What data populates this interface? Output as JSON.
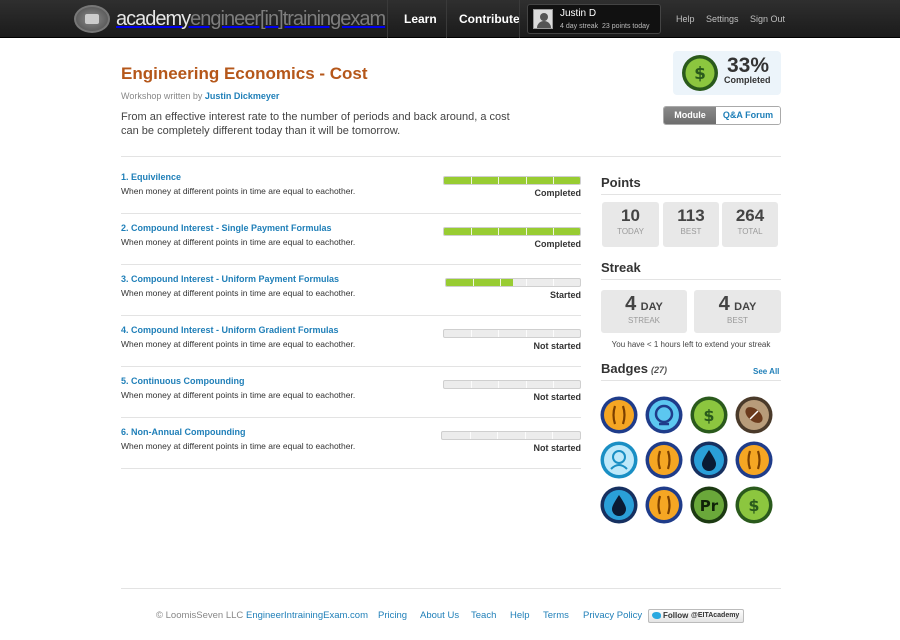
{
  "header": {
    "logo_primary": "academy",
    "logo_secondary": "engineer[in]trainingexam",
    "nav": [
      {
        "label": "Learn"
      },
      {
        "label": "Contribute"
      }
    ],
    "user": {
      "name": "Justin D",
      "streak": "4 day streak",
      "points": "23 points today"
    },
    "links": [
      {
        "label": "Help"
      },
      {
        "label": "Settings"
      },
      {
        "label": "Sign Out"
      }
    ]
  },
  "workshop": {
    "title": "Engineering Economics - Cost",
    "byline_prefix": "Workshop written by",
    "author": "Justin Dickmeyer",
    "intro": "From an effective interest rate to the number of periods and back around, a cost can be completely different today than it will be tomorrow.",
    "progress_percent": "33%",
    "progress_label": "Completed"
  },
  "view_toggle": {
    "module": "Module",
    "forum": "Q&A Forum"
  },
  "modules": [
    {
      "title": "1.  Equivilence",
      "desc": "When money at different points in time are equal to eachother.",
      "status": "Completed",
      "progress": 1.0
    },
    {
      "title": "2. Compound Interest - Single Payment Formulas",
      "desc": "When money at different points in time are equal to eachother.",
      "status": "Completed",
      "progress": 1.0
    },
    {
      "title": "3. Compound Interest - Uniform Payment Formulas",
      "desc": "When money at different points in time are equal to eachother.",
      "status": "Started",
      "progress": 0.5
    },
    {
      "title": "4. Compound Interest - Uniform Gradient Formulas",
      "desc": "When money at different points in time are equal to eachother.",
      "status": "Not started",
      "progress": 0
    },
    {
      "title": "5. Continuous Compounding",
      "desc": "When money at different points in time are equal to eachother.",
      "status": "Not started",
      "progress": 0
    },
    {
      "title": "6. Non-Annual Compounding",
      "desc": "When money at different points in time are equal to eachother.",
      "status": "Not started",
      "progress": 0
    }
  ],
  "points": {
    "heading": "Points",
    "stats": [
      {
        "value": "10",
        "label": "TODAY"
      },
      {
        "value": "113",
        "label": "BEST"
      },
      {
        "value": "264",
        "label": "TOTAL"
      }
    ]
  },
  "streak": {
    "heading": "Streak",
    "current": {
      "value": "4",
      "unit": "DAY",
      "label": "STREAK"
    },
    "best": {
      "value": "4",
      "unit": "DAY",
      "label": "BEST"
    },
    "note": "You have < 1 hours left to extend your streak"
  },
  "badges": {
    "heading": "Badges",
    "count": "(27)",
    "see_all": "See All",
    "items": [
      {
        "icon": "orange-scroll-badge-icon",
        "ring": "#1f3c8a",
        "fill": "#f5a623"
      },
      {
        "icon": "blue-chat-badge-icon",
        "ring": "#1f3c8a",
        "fill": "#5cc7f0"
      },
      {
        "icon": "green-dollar-badge-icon",
        "ring": "#2a5a1c",
        "fill": "#8cc63f"
      },
      {
        "icon": "brown-football-badge-icon",
        "ring": "#4a3a2a",
        "fill": "#b89c7a"
      },
      {
        "icon": "blue-person-badge-icon",
        "ring": "#1a8fc4",
        "fill": "#bfe9fa"
      },
      {
        "icon": "orange-scroll-badge-icon",
        "ring": "#1f3c8a",
        "fill": "#f5a623"
      },
      {
        "icon": "blue-drop-badge-icon",
        "ring": "#163060",
        "fill": "#2a9fd8"
      },
      {
        "icon": "orange-scroll-badge-icon",
        "ring": "#1f3c8a",
        "fill": "#f5a623"
      },
      {
        "icon": "blue-drop-badge-icon",
        "ring": "#163060",
        "fill": "#2a9fd8"
      },
      {
        "icon": "orange-scroll-badge-icon",
        "ring": "#1f3c8a",
        "fill": "#f5a623"
      },
      {
        "icon": "green-pr-badge-icon",
        "ring": "#1c3a12",
        "fill": "#6aa83a",
        "text": "Pr"
      },
      {
        "icon": "green-dollar-badge-icon",
        "ring": "#2a5a1c",
        "fill": "#8cc63f"
      }
    ]
  },
  "footer": {
    "copyright": "© LoomisSeven LLC",
    "links": [
      {
        "label": "EngineerIntrainingExam.com"
      },
      {
        "label": "Pricing"
      },
      {
        "label": "About Us"
      },
      {
        "label": "Teach"
      },
      {
        "label": "Help"
      },
      {
        "label": "Terms"
      },
      {
        "label": "Privacy Policy"
      }
    ],
    "follow": "Follow",
    "handle": "@EITAcademy"
  },
  "colors": {
    "accent_orange": "#b5571a",
    "link_blue": "#1f7fb8",
    "progress_green": "#98cc32"
  }
}
